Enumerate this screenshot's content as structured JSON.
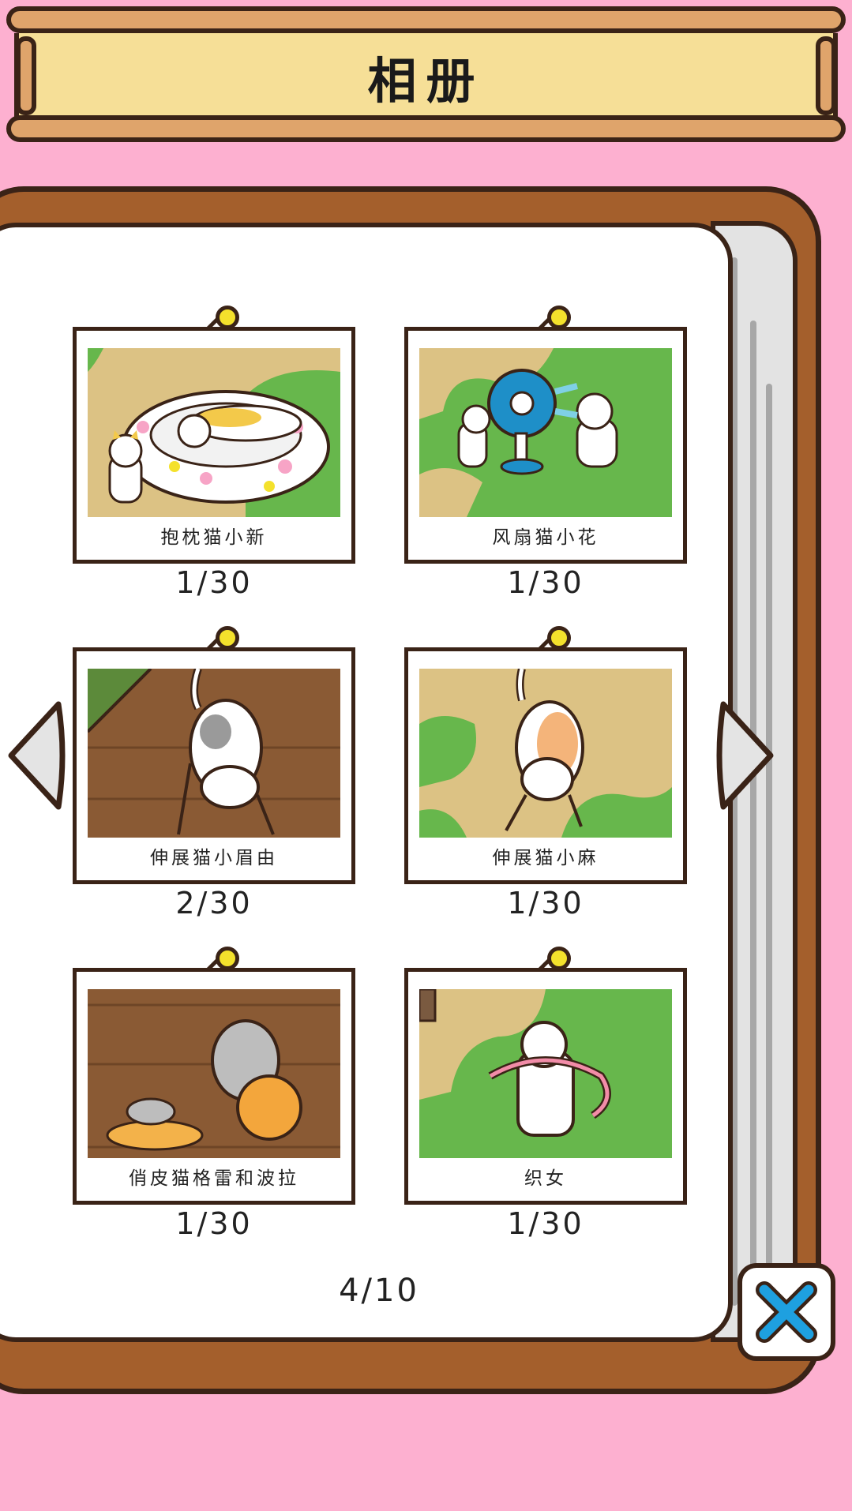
{
  "header": {
    "title": "相册"
  },
  "album": {
    "cards": [
      {
        "name": "抱枕猫小新",
        "count": "1/30"
      },
      {
        "name": "风扇猫小花",
        "count": "1/30"
      },
      {
        "name": "伸展猫小眉由",
        "count": "2/30"
      },
      {
        "name": "伸展猫小麻",
        "count": "1/30"
      },
      {
        "name": "俏皮猫格雷和波拉",
        "count": "1/30"
      },
      {
        "name": "织女",
        "count": "1/30"
      }
    ],
    "page_indicator": "4/10"
  },
  "colors": {
    "background": "#fdb0d0",
    "outline": "#3a2317",
    "book_cover": "#a45f2c",
    "banner": "#f6df97",
    "pin": "#f4e12c",
    "close_x": "#1ea0e0"
  },
  "icons": {
    "prev": "triangle-left-icon",
    "next": "triangle-right-icon",
    "close": "close-x-icon"
  }
}
